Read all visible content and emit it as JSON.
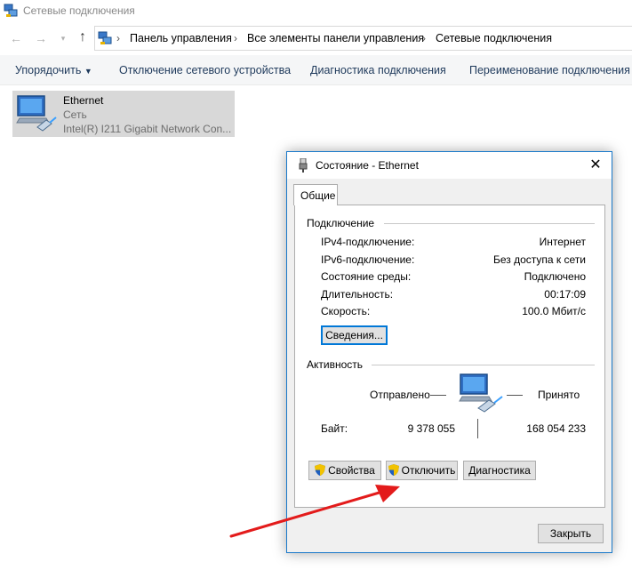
{
  "window": {
    "title": "Сетевые подключения"
  },
  "address": {
    "crumbs": [
      "Панель управления",
      "Все элементы панели управления",
      "Сетевые подключения"
    ]
  },
  "commands": {
    "organize": "Упорядочить",
    "disable": "Отключение сетевого устройства",
    "diagnose": "Диагностика подключения",
    "rename": "Переименование подключения"
  },
  "adapter": {
    "name": "Ethernet",
    "network": "Сеть",
    "device": "Intel(R) I211 Gigabit Network Con..."
  },
  "dialog": {
    "title": "Состояние - Ethernet",
    "tab": "Общие",
    "connection_group": "Подключение",
    "rows": [
      {
        "label": "IPv4-подключение:",
        "value": "Интернет"
      },
      {
        "label": "IPv6-подключение:",
        "value": "Без доступа к сети"
      },
      {
        "label": "Состояние среды:",
        "value": "Подключено"
      },
      {
        "label": "Длительность:",
        "value": "00:17:09"
      },
      {
        "label": "Скорость:",
        "value": "100.0 Мбит/с"
      }
    ],
    "details_button": "Сведения...",
    "activity_group": "Активность",
    "sent_label": "Отправлено",
    "received_label": "Принято",
    "bytes_label": "Байт:",
    "bytes_sent": "9 378 055",
    "bytes_received": "168 054 233",
    "properties_button": "Свойства",
    "disable_button": "Отключить",
    "diagnose_button": "Диагностика",
    "close_button": "Закрыть"
  },
  "colors": {
    "accent": "#0078d7",
    "arrow": "#e31b1b",
    "command_text": "#1e395b"
  }
}
